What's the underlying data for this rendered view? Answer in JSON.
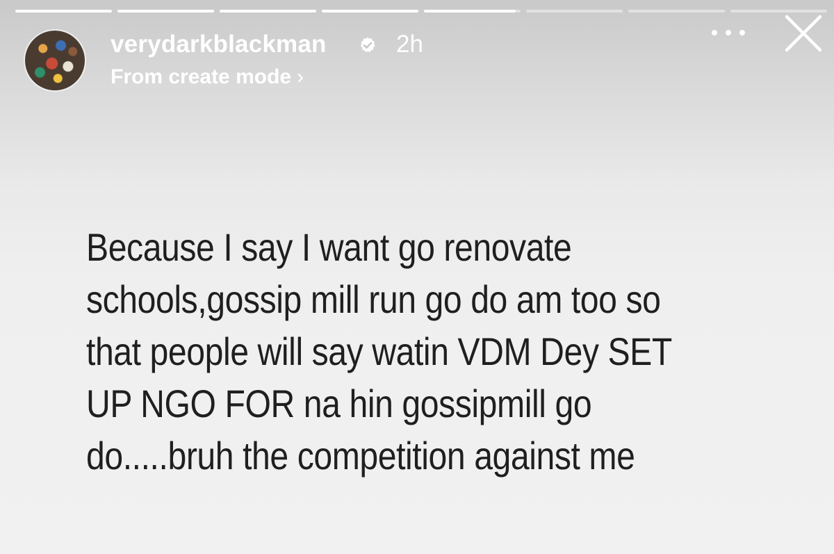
{
  "progress": {
    "segments": [
      1,
      1,
      1,
      1,
      0.95,
      0,
      0,
      0
    ]
  },
  "header": {
    "username": "verydarkblackman",
    "time": "2h",
    "subtitle": "From create mode",
    "subtitle_chevron": "›",
    "verified_icon": "verified-badge-icon",
    "more_icon": "more-horizontal-icon",
    "close_icon": "close-icon"
  },
  "story": {
    "lines": [
      "Because I say I want go renovate",
      "schools,gossip mill run go do am too so",
      "that people will say watin VDM Dey SET",
      "UP NGO FOR na hin gossipmill go",
      "do.....bruh the competition against me"
    ]
  },
  "colors": {
    "text": "#1f1f1f",
    "header_text": "#ffffff"
  }
}
